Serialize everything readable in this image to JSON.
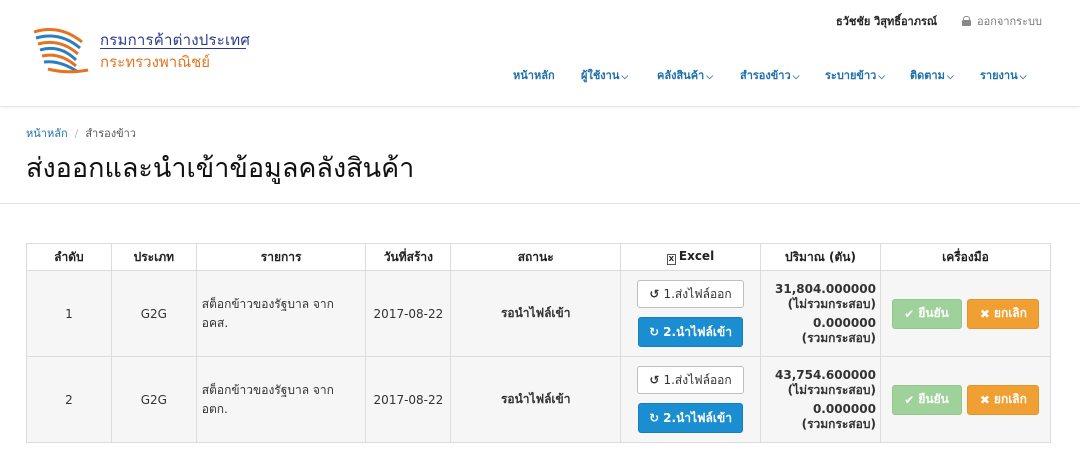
{
  "header": {
    "org_name_line1": "กรมการค้าต่างประเทศ",
    "org_name_line2": "กระทรวงพาณิชย์",
    "user_name": "ธวัชชัย วิสุทธิ์อาภรณ์",
    "logout_label": "ออกจากระบบ",
    "logo_icon": "swoosh-logo-icon",
    "colors": {
      "brand_blue": "#2b3a8c",
      "brand_orange": "#e8731f",
      "nav_blue": "#1f6fa8"
    }
  },
  "nav": {
    "items": [
      {
        "label": "หน้าหลัก",
        "has_dropdown": false
      },
      {
        "label": "ผู้ใช้งาน",
        "has_dropdown": true
      },
      {
        "label": "คลังสินค้า",
        "has_dropdown": true
      },
      {
        "label": "สำรองข้าว",
        "has_dropdown": true
      },
      {
        "label": "ระบายข้าว",
        "has_dropdown": true
      },
      {
        "label": "ติดตาม",
        "has_dropdown": true
      },
      {
        "label": "รายงาน",
        "has_dropdown": true
      }
    ]
  },
  "breadcrumb": {
    "home": "หน้าหลัก",
    "separator": "/",
    "current": "สำรองข้าว"
  },
  "page": {
    "title": "ส่งออกและนำเข้าข้อมูลคลังสินค้า"
  },
  "table": {
    "columns": [
      "ลำดับ",
      "ประเภท",
      "รายการ",
      "วันที่สร้าง",
      "สถานะ",
      "Excel",
      "ปริมาณ (ตัน)",
      "เครื่องมือ"
    ],
    "excel_icon_letter": "X",
    "rows": [
      {
        "no": "1",
        "type": "G2G",
        "item": "สต็อกข้าวของรัฐบาล จาก อคส.",
        "created": "2017-08-22",
        "status": "รอนำไฟล์เข้า",
        "export_label": "1.ส่งไฟล์ออก",
        "import_label": "2.นำไฟล์เข้า",
        "qty_excl": "31,804.000000",
        "qty_excl_note": "(ไม่รวมกระสอบ)",
        "qty_incl": "0.000000",
        "qty_incl_note": "(รวมกระสอบ)",
        "confirm_label": "ยืนยัน",
        "cancel_label": "ยกเลิก"
      },
      {
        "no": "2",
        "type": "G2G",
        "item": "สต็อกข้าวของรัฐบาล จาก อตก.",
        "created": "2017-08-22",
        "status": "รอนำไฟล์เข้า",
        "export_label": "1.ส่งไฟล์ออก",
        "import_label": "2.นำไฟล์เข้า",
        "qty_excl": "43,754.600000",
        "qty_excl_note": "(ไม่รวมกระสอบ)",
        "qty_incl": "0.000000",
        "qty_incl_note": "(รวมกระสอบ)",
        "confirm_label": "ยืนยัน",
        "cancel_label": "ยกเลิก"
      }
    ],
    "colors": {
      "status": "#f0a33a",
      "import_button": "#1a8ed1",
      "confirm_button": "#9fd29a",
      "cancel_button": "#f0a032"
    }
  },
  "icons": {
    "lock": "lock-icon",
    "chevron": "chevron-down-icon",
    "excel": "excel-file-icon",
    "undo": "undo-icon",
    "refresh": "refresh-icon",
    "check": "check-icon",
    "close": "close-icon"
  }
}
